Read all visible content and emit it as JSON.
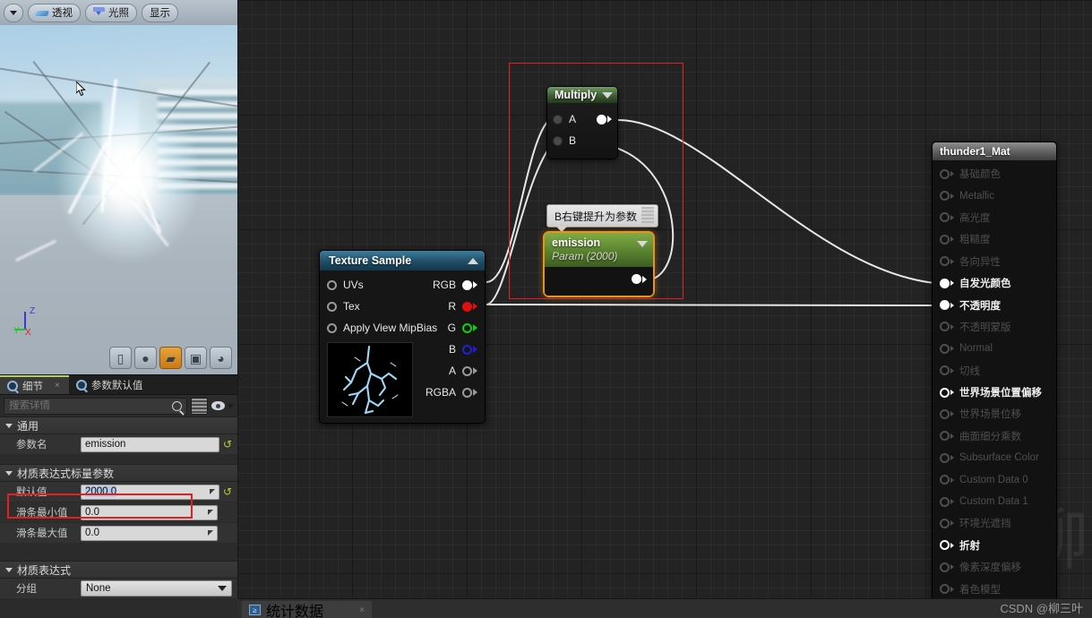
{
  "viewport_toolbar": {
    "dropdown_icon": "caret-down-icon",
    "perspective_label": "透视",
    "lighting_label": "光照",
    "show_label": "显示"
  },
  "viewport": {
    "axis": {
      "x": "X",
      "y": "Y",
      "z": "Z"
    },
    "preview_shapes": [
      {
        "name": "cylinder",
        "glyph": "▯",
        "active": false
      },
      {
        "name": "sphere",
        "glyph": "●",
        "active": false
      },
      {
        "name": "plane",
        "glyph": "▰",
        "active": true
      },
      {
        "name": "cube",
        "glyph": "▣",
        "active": false
      },
      {
        "name": "teapot",
        "glyph": "◕",
        "active": false
      }
    ]
  },
  "details": {
    "tabs": [
      {
        "label": "细节",
        "icon": "magnifier-icon",
        "active": true,
        "close": "×"
      },
      {
        "label": "参数默认值",
        "icon": "magnifier-icon",
        "active": false
      }
    ],
    "search_placeholder": "搜索详情",
    "search_value": "",
    "sections": [
      {
        "title": "通用",
        "rows": [
          {
            "label": "参数名",
            "type": "text",
            "value": "emission",
            "selected": false,
            "revert": "↺"
          }
        ]
      },
      {
        "title": "材质表达式标量参数",
        "rows": [
          {
            "label": "默认值",
            "type": "number",
            "value": "2000.0",
            "selected": true,
            "revert": "↺"
          },
          {
            "label": "滑条最小值",
            "type": "number",
            "value": "0.0",
            "selected": false,
            "revert": ""
          },
          {
            "label": "滑条最大值",
            "type": "number",
            "value": "0.0",
            "selected": false,
            "revert": ""
          }
        ]
      },
      {
        "title": "材质表达式",
        "rows": [
          {
            "label": "分组",
            "type": "select",
            "value": "None",
            "selected": false,
            "revert": ""
          }
        ]
      }
    ]
  },
  "graph": {
    "multiply_node": {
      "title": "Multiply",
      "inputs": [
        "A",
        "B"
      ],
      "outputs": [
        "",
        ""
      ],
      "header_color": "#3b5730"
    },
    "tooltip": {
      "text": "B右键提升为参数"
    },
    "emission_node": {
      "title": "emission",
      "subtitle": "Param (2000)",
      "highlight_color": "#e8941c",
      "header_color": "#5f8a33"
    },
    "texture_sample_node": {
      "title": "Texture Sample",
      "inputs": [
        "UVs",
        "Tex",
        "Apply View MipBias"
      ],
      "outputs": [
        "RGB",
        "R",
        "G",
        "B",
        "A",
        "RGBA"
      ],
      "header_color": "#1f4d66"
    },
    "material_node": {
      "title": "thunder1_Mat",
      "pins": [
        {
          "label": "基础颜色",
          "connected": false
        },
        {
          "label": "Metallic",
          "connected": false
        },
        {
          "label": "高光度",
          "connected": false
        },
        {
          "label": "粗糙度",
          "connected": false
        },
        {
          "label": "各向异性",
          "connected": false
        },
        {
          "label": "自发光颜色",
          "connected": true
        },
        {
          "label": "不透明度",
          "connected": true
        },
        {
          "label": "不透明蒙版",
          "connected": false
        },
        {
          "label": "Normal",
          "connected": false
        },
        {
          "label": "切线",
          "connected": false
        },
        {
          "label": "世界场景位置偏移",
          "connected": false,
          "bold": true
        },
        {
          "label": "世界场景位移",
          "connected": false
        },
        {
          "label": "曲面细分乘数",
          "connected": false
        },
        {
          "label": "Subsurface Color",
          "connected": false
        },
        {
          "label": "Custom Data 0",
          "connected": false
        },
        {
          "label": "Custom Data 1",
          "connected": false
        },
        {
          "label": "环境光遮挡",
          "connected": false
        },
        {
          "label": "折射",
          "connected": false,
          "bold": true
        },
        {
          "label": "像素深度偏移",
          "connected": false
        },
        {
          "label": "着色模型",
          "connected": false
        }
      ]
    }
  },
  "bottom_bar": {
    "stats_tab_label": "统计数据",
    "stats_tab_close": "×",
    "watermark": "CSDN @柳三叶"
  },
  "watermark_graph": "柳"
}
